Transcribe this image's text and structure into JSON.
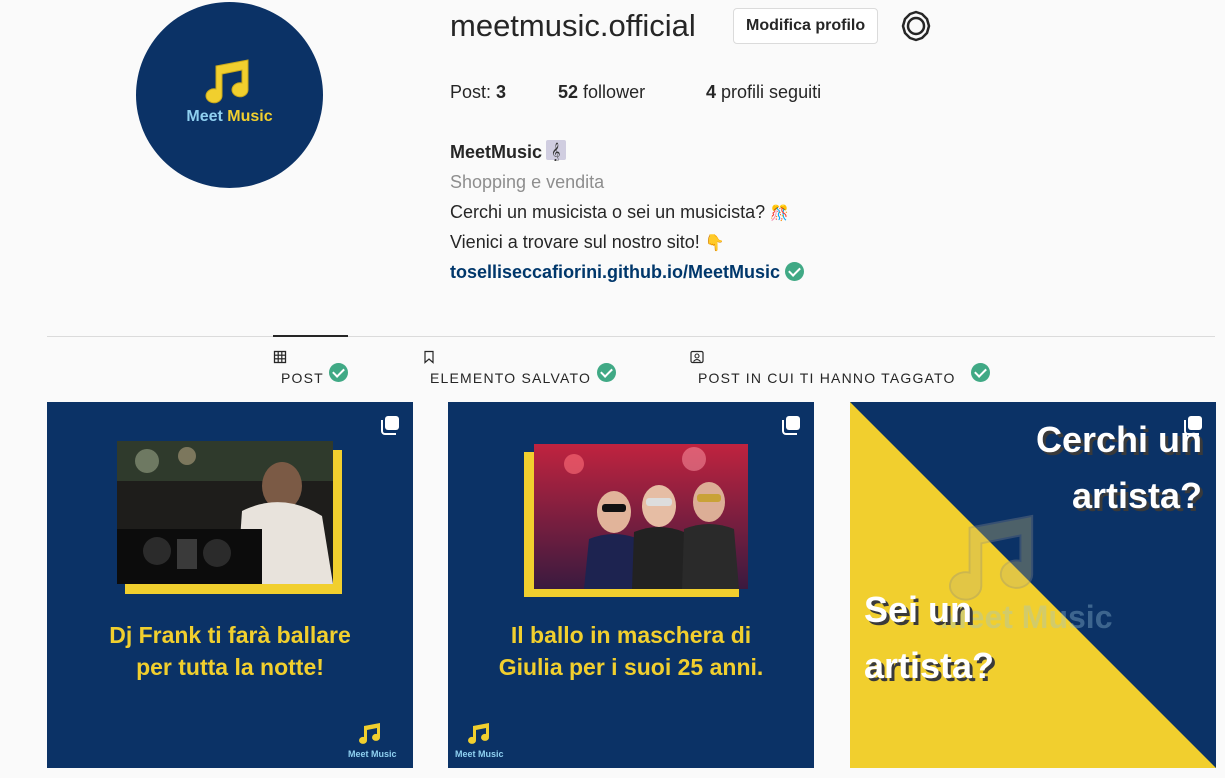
{
  "profile": {
    "username": "meetmusic.official",
    "edit_button": "Modifica profilo",
    "avatar": {
      "brand_part1": "Meet",
      "brand_part2": "Music"
    },
    "stats": {
      "posts_label": "Post:",
      "posts_count": "3",
      "followers_count": "52",
      "followers_label": "follower",
      "following_count": "4",
      "following_label": "profili seguiti"
    },
    "bio": {
      "name": "MeetMusic",
      "category": "Shopping e vendita",
      "line1": "Cerchi un musicista o sei un musicista?",
      "line1_emoji": "🎊",
      "line2": "Vienici a trovare sul nostro sito!",
      "line2_emoji": "👇",
      "link": "tosellis­eccafiorini.github.io/MeetMusic"
    }
  },
  "tabs": [
    {
      "label": "POST",
      "icon": "grid-icon",
      "active": true
    },
    {
      "label": "ELEMENTO SALVATO",
      "icon": "bookmark-icon",
      "active": false
    },
    {
      "label": "POST IN CUI TI HANNO TAGGATO",
      "icon": "tagged-user-icon",
      "active": false
    }
  ],
  "posts": [
    {
      "caption": "Dj Frank ti farà ballare per tutta la notte!",
      "logo": "Meet Music"
    },
    {
      "caption": "Il ballo in maschera di Giulia per i suoi 25 anni.",
      "logo": "Meet Music"
    },
    {
      "text_top": "Cerchi un artista?",
      "text_bottom": "Sei un artista?",
      "watermark": "Meet Music"
    }
  ],
  "colors": {
    "navy": "#0b3266",
    "yellow": "#f1cf2e",
    "check_green": "#40a985",
    "link": "#00376b"
  }
}
